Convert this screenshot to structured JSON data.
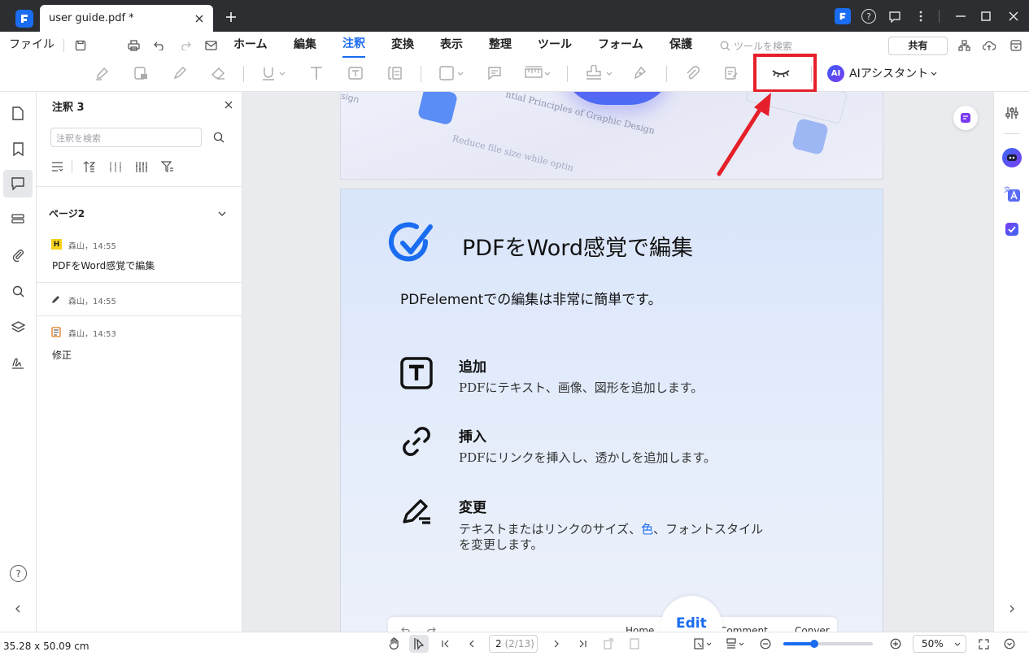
{
  "window": {
    "tab_title": "user guide.pdf *"
  },
  "menubar": {
    "file": "ファイル",
    "items": [
      "ホーム",
      "編集",
      "注釈",
      "変換",
      "表示",
      "整理",
      "ツール",
      "フォーム",
      "保護"
    ],
    "active": "注釈",
    "search_placeholder": "ツールを検索",
    "share": "共有"
  },
  "toolbar": {
    "ai_assistant": "AIアシスタント",
    "ai_badge": "AI"
  },
  "panel": {
    "title": "注釈 3",
    "search_placeholder": "注釈を検索",
    "page_group": "ページ2",
    "annotations": [
      {
        "badge": "H",
        "meta": "森山，14:55",
        "text": "PDFをWord感覚で編集"
      },
      {
        "badge": "",
        "meta": "森山，14:55",
        "text": ""
      },
      {
        "badge": "",
        "meta": "森山，14:53",
        "text": "修正"
      }
    ]
  },
  "document": {
    "top_image_texts": [
      "sign",
      "ntial Principles of Graphic Design",
      "Reduce file size while optin"
    ],
    "heading": "PDFをWord感覚で編集",
    "intro": "PDFelementでの編集は非常に簡単です。",
    "features": [
      {
        "title": "追加",
        "desc": "PDFにテキスト、画像、図形を追加します。"
      },
      {
        "title": "挿入",
        "desc": "PDFにリンクを挿入し、透かしを追加します。"
      },
      {
        "title": "変更",
        "desc_a": "テキストまたはリンクのサイズ、",
        "desc_color": "色",
        "desc_b": "、フォントスタイル",
        "desc_c": "を変更します。"
      }
    ],
    "bottom_bar": {
      "edit": "Edit",
      "home": "Home",
      "comment": "Comment",
      "convert": "Conver"
    }
  },
  "status": {
    "dimensions": "35.28 x 50.09 cm",
    "page": "2",
    "page_total": "(2/13)",
    "zoom": "50%",
    "zoom_fraction": 0.2
  },
  "colors": {
    "accent": "#1a6cf0",
    "highlight_box": "#e5202a",
    "titlebar": "#2d2e32"
  }
}
